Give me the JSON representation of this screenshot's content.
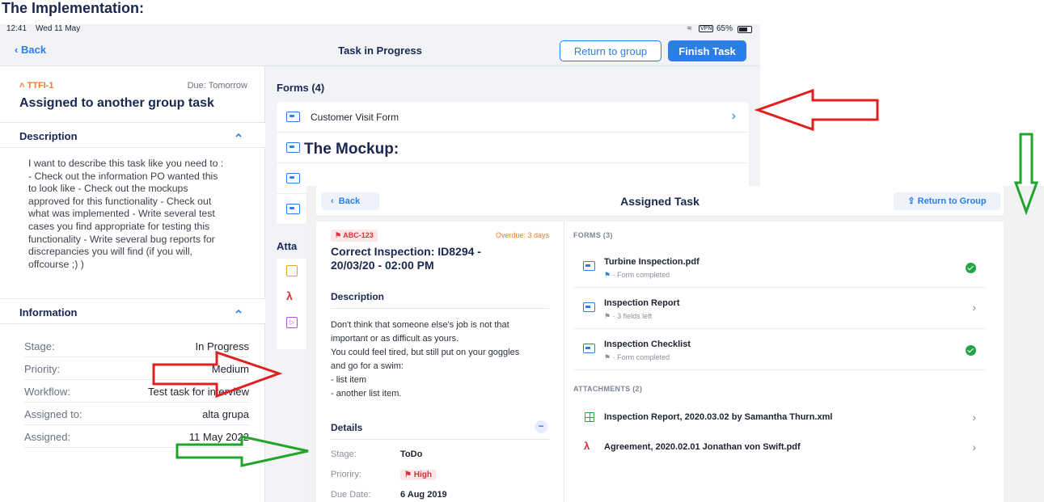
{
  "headings": {
    "implementation": "The Implementation:",
    "mockup": "The Mockup:"
  },
  "implementation": {
    "status_bar": {
      "time": "12:41",
      "date": "Wed 11 May",
      "vpn": "VPN",
      "battery": "65%"
    },
    "nav": {
      "back": "Back",
      "title": "Task in Progress",
      "return_button": "Return to group",
      "finish_button": "Finish Task"
    },
    "task": {
      "id": "TTFI-1",
      "due": "Due: Tomorrow",
      "title": "Assigned to another group task"
    },
    "description": {
      "header": "Description",
      "lines": [
        "I want to describe this task like you need to :",
        "- Check out the information PO wanted this",
        "to look like  - Check out the mockups",
        "approved for this functionality - Check out",
        "what was implemented  - Write several test",
        "cases you find appropriate for testing this",
        "functionality - Write several bug reports for",
        "discrepancies you will find (if you will,",
        "offcourse ;) )"
      ]
    },
    "information": {
      "header": "Information",
      "rows": [
        {
          "label": "Stage:",
          "value": "In Progress"
        },
        {
          "label": "Priority:",
          "value": "Medium"
        },
        {
          "label": "Workflow:",
          "value": "Test task for interview"
        },
        {
          "label": "Assigned to:",
          "value": "alta grupa"
        },
        {
          "label": "Assigned:",
          "value": "11 May 2022"
        }
      ]
    },
    "forms": {
      "header": "Forms (4)",
      "items": [
        {
          "name": "Customer Visit Form"
        }
      ]
    },
    "attachments": {
      "header_partial": "Atta"
    }
  },
  "mockup": {
    "nav": {
      "back": "Back",
      "title": "Assigned Task",
      "return_button": "Return to Group"
    },
    "task": {
      "id": "ABC-123",
      "overdue": "Overdue: 3 days",
      "title_line1": "Correct Inspection: ID8294 -",
      "title_line2": "20/03/20 - 02:00 PM"
    },
    "description": {
      "header": "Description",
      "lines": [
        "Don't think that someone else's job is not that",
        "important or as difficult as yours.",
        "You could feel tired, but still put on your goggles",
        "and go for a swim:",
        "- list item",
        "- another list item."
      ]
    },
    "details": {
      "header": "Details",
      "rows": [
        {
          "label": "Stage:",
          "value": "ToDo"
        },
        {
          "label": "Prioriry:",
          "value": "High"
        },
        {
          "label": "Due Date:",
          "value": "6 Aug 2019"
        }
      ]
    },
    "forms": {
      "header": "FORMS (3)",
      "items": [
        {
          "name": "Turbine Inspection.pdf",
          "status": "Form completed",
          "state": "completed"
        },
        {
          "name": "Inspection Report",
          "status": "3 fields left",
          "state": "open"
        },
        {
          "name": "Inspection Checklist",
          "status": "Form completed",
          "state": "completed"
        }
      ]
    },
    "attachments": {
      "header": "ATTACHMENTS (2)",
      "items": [
        {
          "name": "Inspection Report, 2020.03.02 by Samantha Thurn.xml",
          "type": "spreadsheet"
        },
        {
          "name": "Agreement, 2020.02.01 Jonathan von Swift.pdf",
          "type": "pdf"
        }
      ]
    }
  },
  "colors": {
    "accent_blue": "#2b7de9",
    "arrow_red": "#e02020",
    "arrow_green": "#22a32a",
    "overdue_orange": "#f07a2a",
    "badge_red": "#d8313a"
  }
}
